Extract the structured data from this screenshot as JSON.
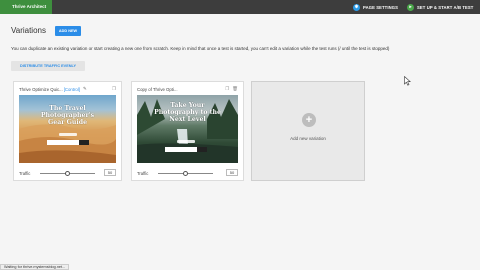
{
  "topbar": {
    "brand": "Thrive Architect",
    "page_settings_label": "PAGE SETTINGS",
    "ab_test_label": "SET UP & START A/B TEST"
  },
  "header": {
    "title": "Variations",
    "add_new_label": "ADD NEW",
    "info_text": "You can duplicate an existing variation or start creating a new one from scratch. Keep in mind that once a test is started, you can't edit a variation while the test runs (/ until the test is stopped)",
    "distribute_label": "DISTRIBUTE TRAFFIC EVENLY"
  },
  "variations": [
    {
      "name": "Thrive Optimize Quic...",
      "badge": "[Control]",
      "thumb_text": "The Travel Photographer's Gear Guide",
      "traffic_label": "Traffic",
      "traffic_value": "50",
      "traffic_fraction": 0.5
    },
    {
      "name": "Copy of Thrive Opti...",
      "badge": "",
      "thumb_text": "Take Your Photography to the Next Level",
      "traffic_label": "Traffic",
      "traffic_value": "50",
      "traffic_fraction": 0.5
    }
  ],
  "add_card": {
    "label": "Add new variation"
  },
  "status_bar": {
    "text": "Waiting for thrive.mystemsblog.net..."
  },
  "colors": {
    "accent": "#2b8de8",
    "brand": "#3e8f3e",
    "topbar": "#3d3d3d"
  },
  "icons": [
    "gear-icon",
    "play-icon",
    "pencil-icon",
    "duplicate-icon",
    "trash-icon",
    "plus-icon",
    "cursor-icon"
  ]
}
